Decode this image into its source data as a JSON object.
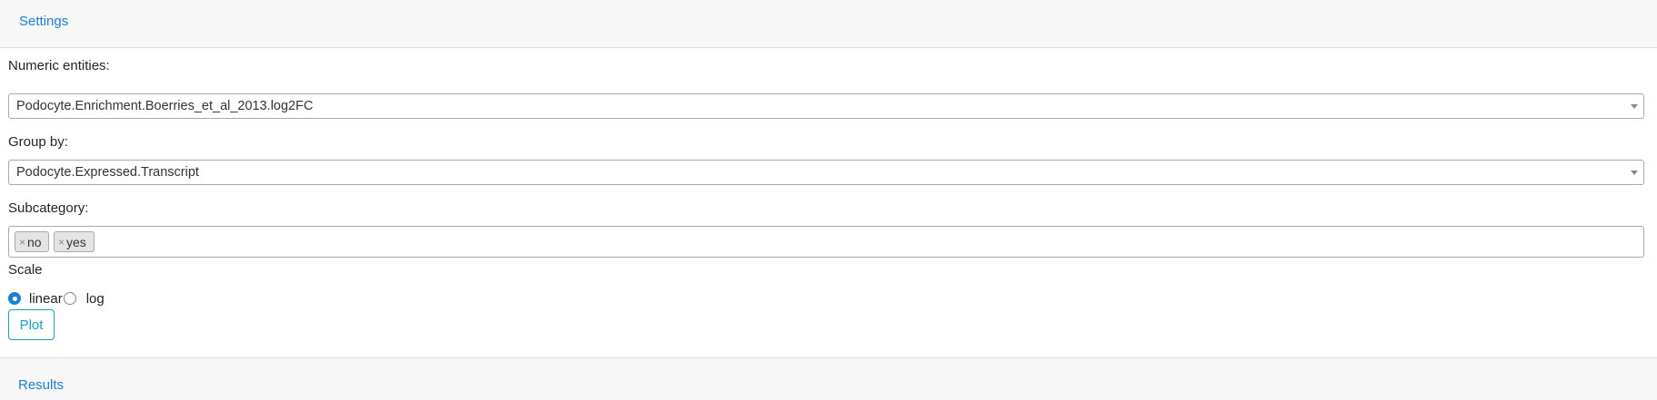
{
  "settings_header": {
    "label": "Settings"
  },
  "numeric_entities": {
    "label": "Numeric entities:",
    "value": "Podocyte.Enrichment.Boerries_et_al_2013.log2FC"
  },
  "group_by": {
    "label": "Group by:",
    "value": "Podocyte.Expressed.Transcript"
  },
  "subcategory": {
    "label": "Subcategory:",
    "chips": [
      {
        "remove": "×",
        "label": "no"
      },
      {
        "remove": "×",
        "label": "yes"
      }
    ]
  },
  "scale": {
    "label": "Scale",
    "options": [
      {
        "label": "linear",
        "selected": true
      },
      {
        "label": "log",
        "selected": false
      }
    ]
  },
  "plot_button": {
    "label": "Plot"
  },
  "results_header": {
    "label": "Results"
  },
  "colors": {
    "link": "#1a7fd6",
    "button_accent": "#17a2b8",
    "header_bg": "#f7f7f7"
  }
}
